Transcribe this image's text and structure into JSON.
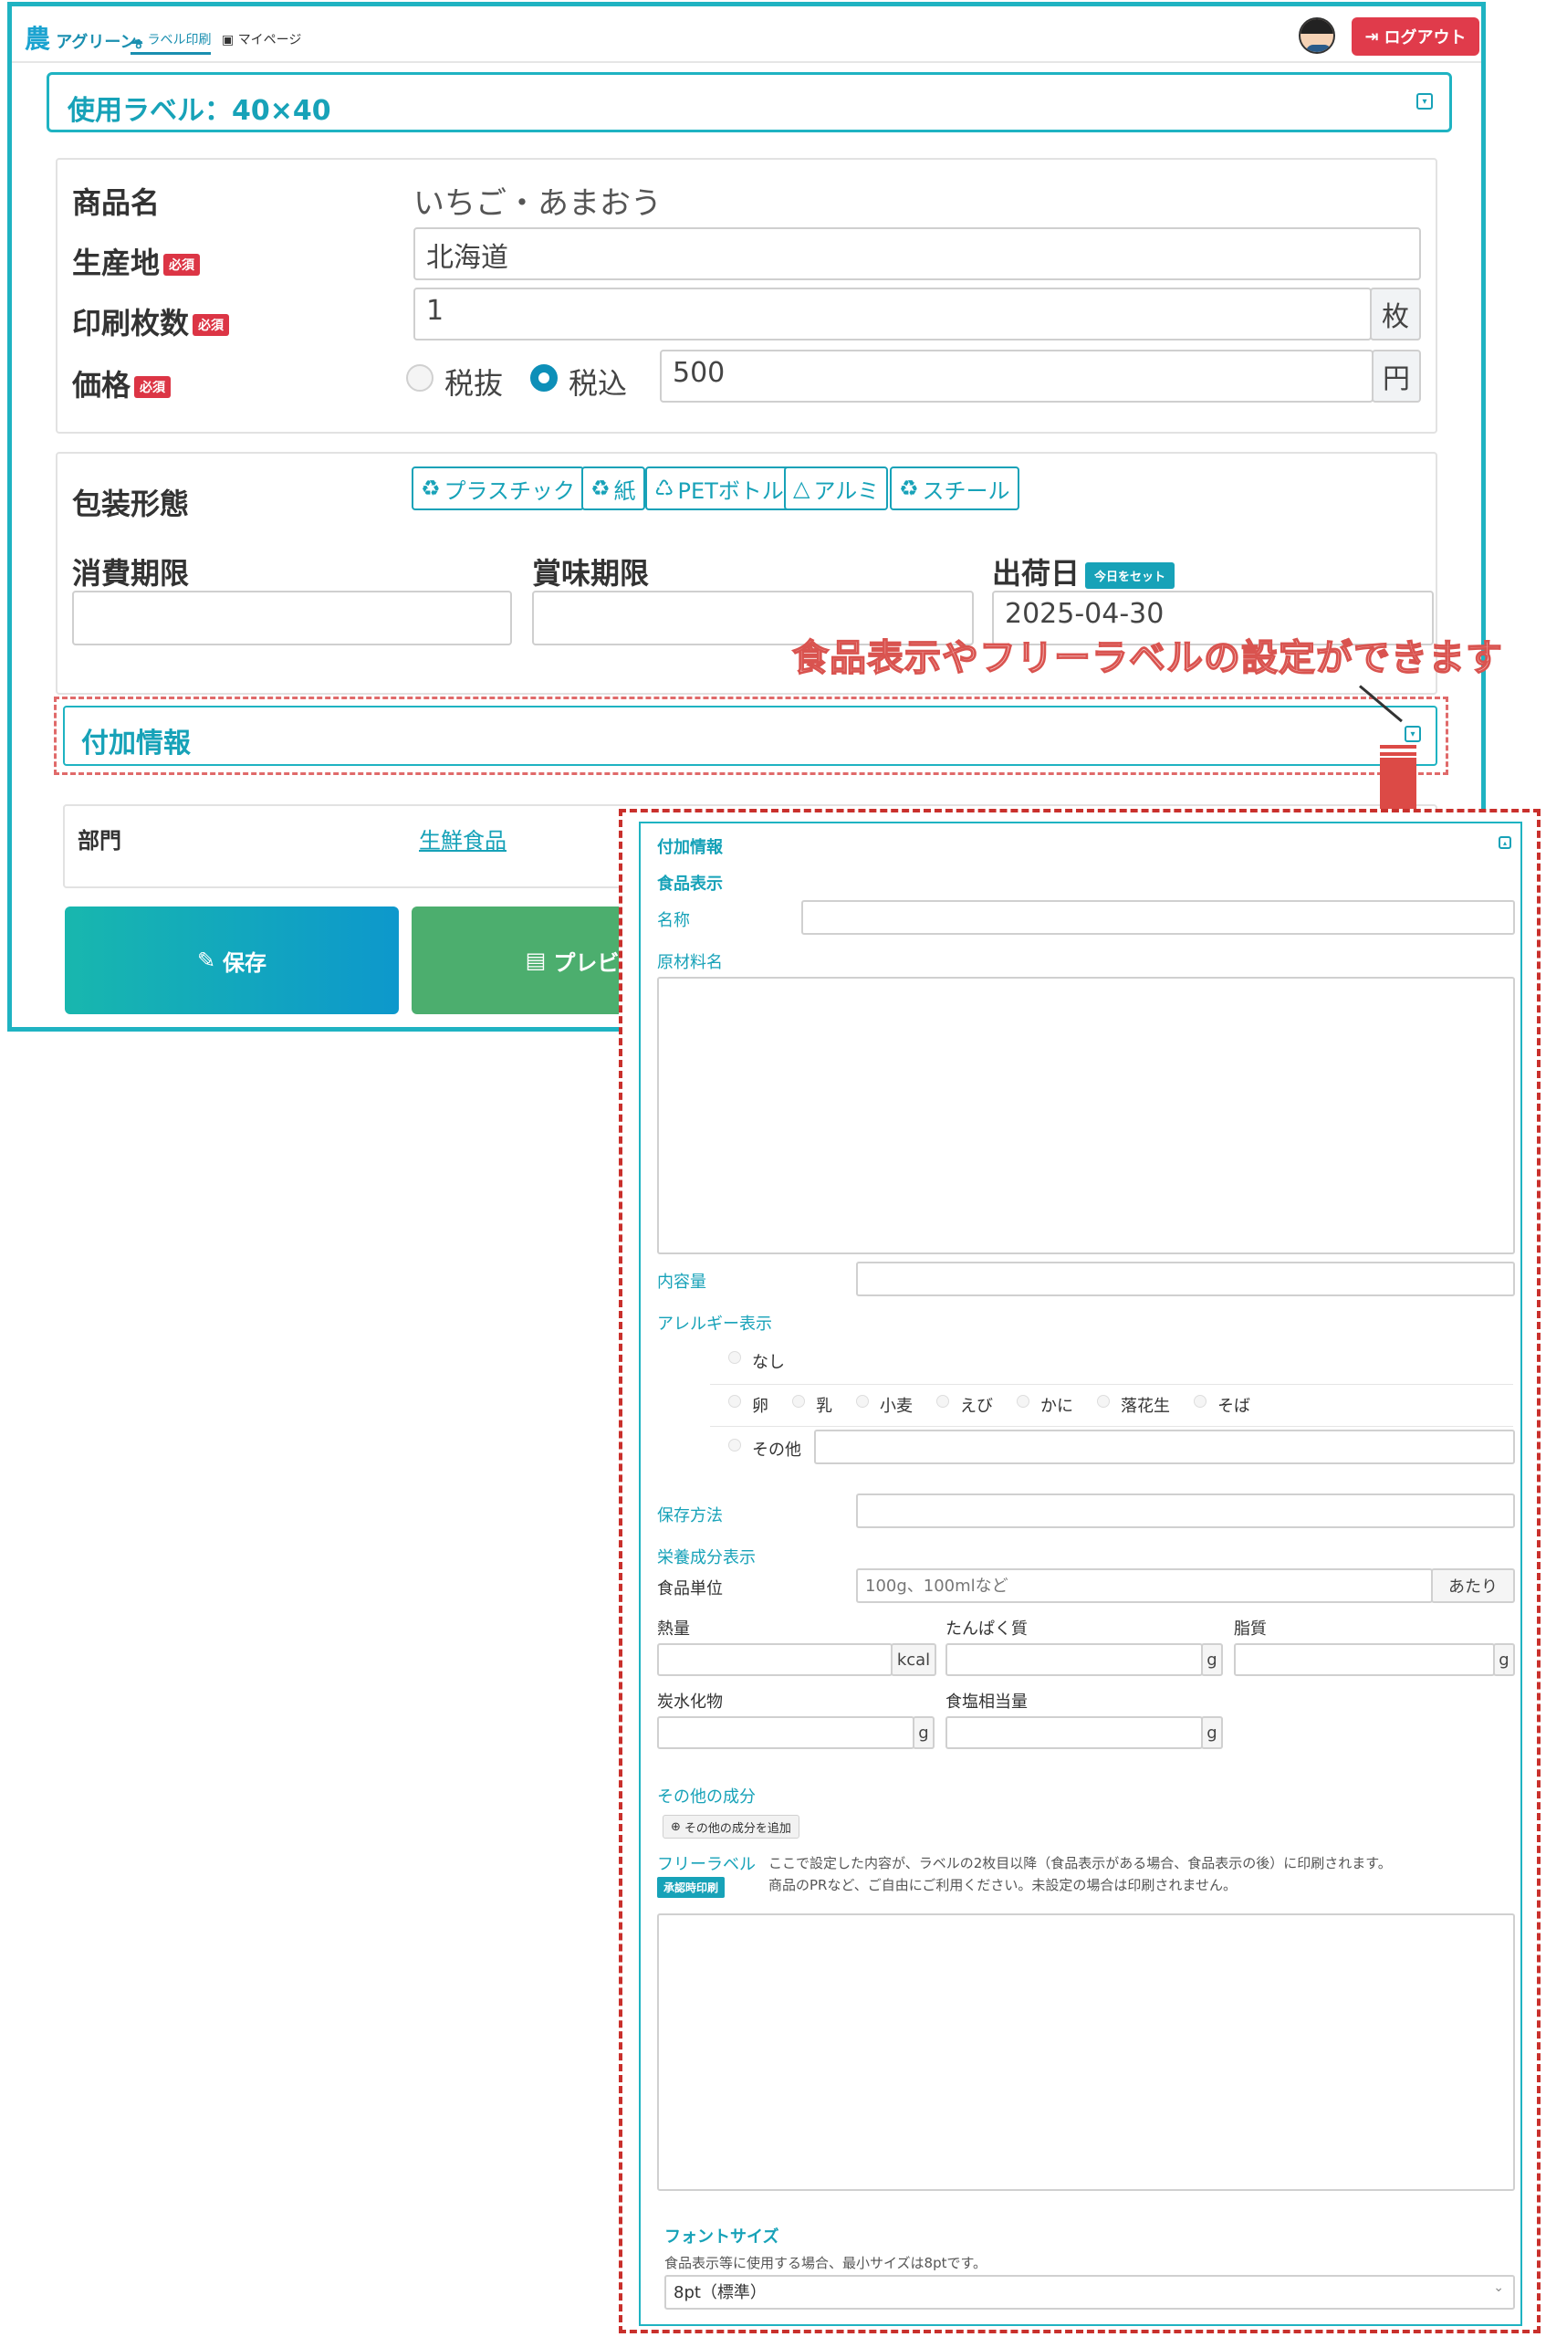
{
  "header": {
    "logo_text": "アグリーン。",
    "nav_label_print": "ラベル印刷",
    "nav_mypage": "マイページ",
    "logout_label": "ログアウト"
  },
  "label_card": {
    "title": "使用ラベル：40×40"
  },
  "product": {
    "name_label": "商品名",
    "name_value": "いちご・あまおう",
    "origin_label": "生産地",
    "origin_value": "北海道",
    "copies_label": "印刷枚数",
    "copies_value": "1",
    "copies_unit": "枚",
    "price_label": "価格",
    "tax_excluded": "税抜",
    "tax_included": "税込",
    "price_value": "500",
    "price_unit": "円",
    "required_badge": "必須"
  },
  "packaging": {
    "label": "包装形態",
    "options": [
      "プラスチック",
      "紙",
      "PETボトル",
      "アルミ",
      "スチール"
    ]
  },
  "dates": {
    "consume_label": "消費期限",
    "consume_value": "",
    "best_label": "賞味期限",
    "best_value": "",
    "ship_label": "出荷日",
    "ship_today_button": "今日をセット",
    "ship_value": "2025-04-30"
  },
  "callout": "食品表示やフリーラベルの設定ができます",
  "additional": {
    "title": "付加情報"
  },
  "department": {
    "label": "部門",
    "value": "生鮮食品"
  },
  "actions": {
    "save_label": "保存",
    "preview_label": "プレビュー"
  },
  "detail": {
    "title": "付加情報",
    "food_display": "食品表示",
    "name_label": "名称",
    "ingredients_label": "原材料名",
    "content_label": "内容量",
    "allergy_label": "アレルギー表示",
    "allergy_none": "なし",
    "allergens": [
      "卵",
      "乳",
      "小麦",
      "えび",
      "かに",
      "落花生",
      "そば"
    ],
    "allergy_other": "その他",
    "storage_label": "保存方法",
    "nutrition_label": "栄養成分表示",
    "unit_label": "食品単位",
    "unit_placeholder": "100g、100mlなど",
    "unit_suffix": "あたり",
    "energy_label": "熱量",
    "energy_unit": "kcal",
    "protein_label": "たんぱく質",
    "protein_unit": "g",
    "fat_label": "脂質",
    "fat_unit": "g",
    "carb_label": "炭水化物",
    "carb_unit": "g",
    "salt_label": "食塩相当量",
    "salt_unit": "g",
    "other_components_label": "その他の成分",
    "add_component_button": "その他の成分を追加",
    "free_label": "フリーラベル",
    "approve_badge": "承認時印刷",
    "free_note_1": "ここで設定した内容が、ラベルの2枚目以降（食品表示がある場合、食品表示の後）に印刷されます。",
    "free_note_2": "商品のPRなど、ご自由にご利用ください。未設定の場合は印刷されません。",
    "font_size_label": "フォントサイズ",
    "font_size_note": "食品表示等に使用する場合、最小サイズは8ptです。",
    "font_size_value": "8pt（標準）"
  }
}
